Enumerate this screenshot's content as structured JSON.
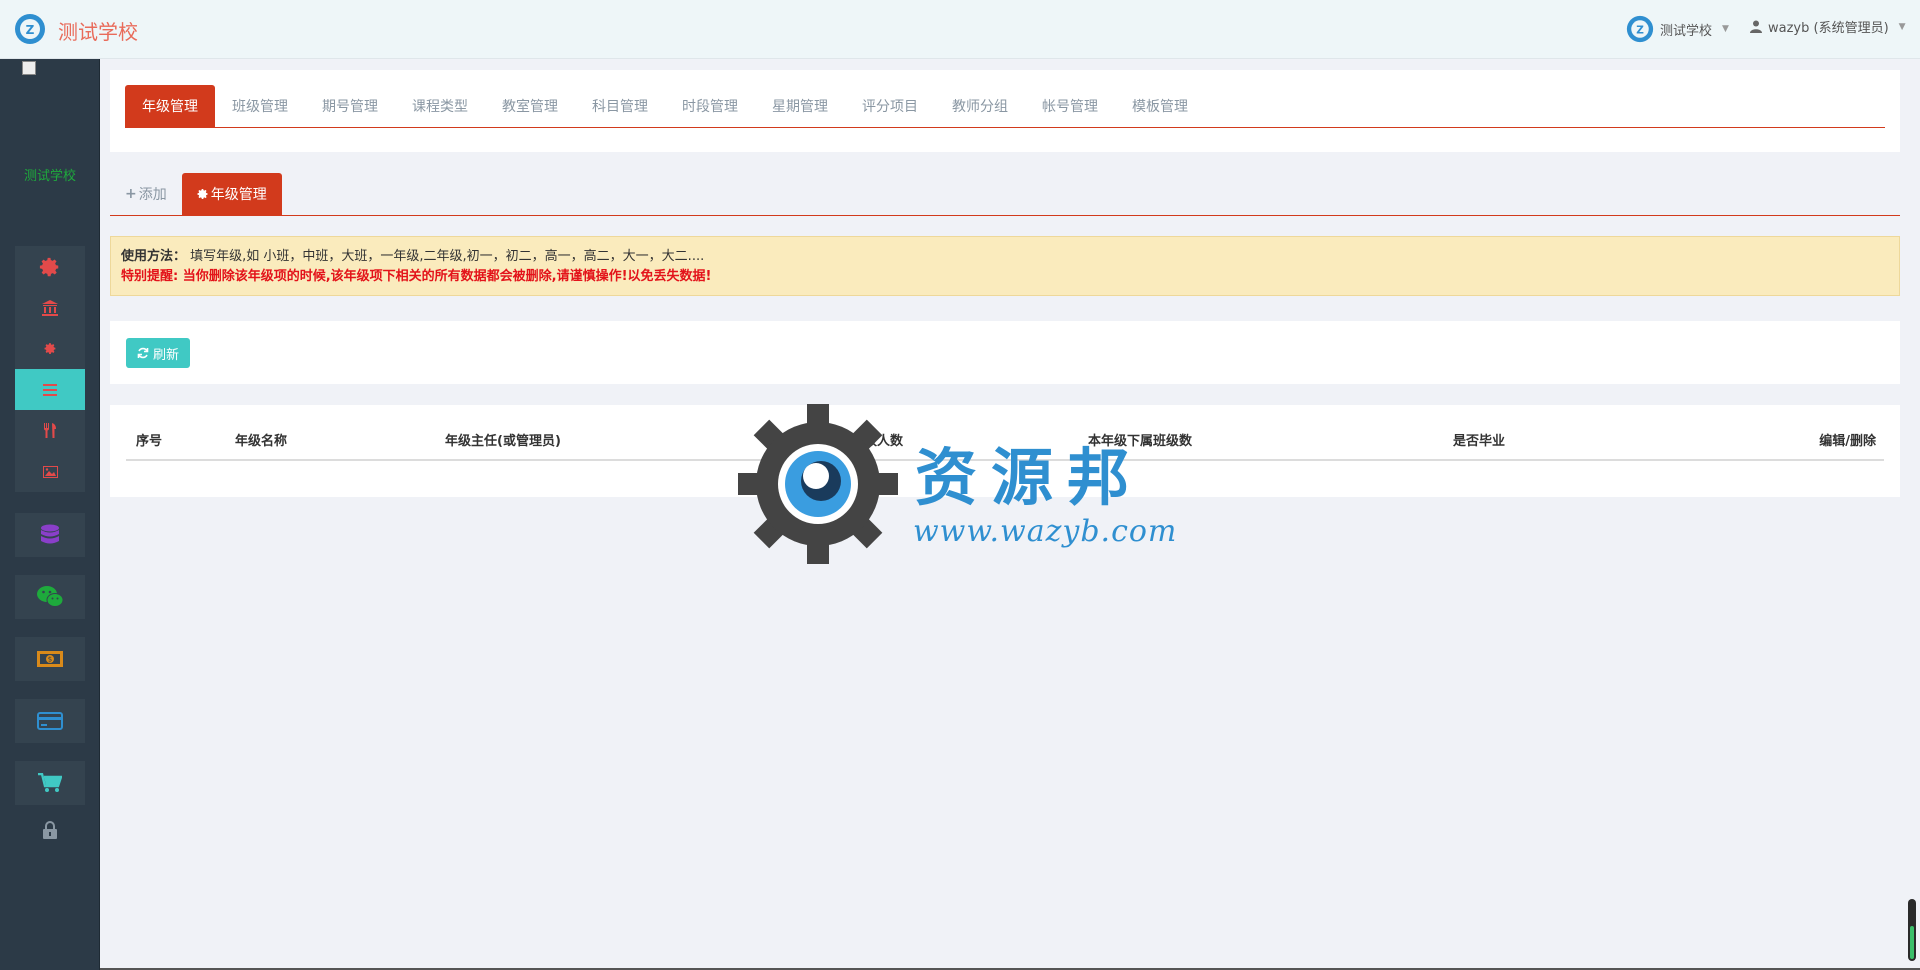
{
  "topbar": {
    "brand": "测试学校",
    "school_switch": "测试学校",
    "user": "wazyb (系统管理员)"
  },
  "sidebar": {
    "school_name": "测试学校",
    "items": [
      {
        "icon": "gear-icon"
      },
      {
        "icon": "bank-icon"
      },
      {
        "icon": "small-gear-icon"
      },
      {
        "icon": "list-icon",
        "active": true
      },
      {
        "icon": "cutlery-icon"
      },
      {
        "icon": "image-icon"
      },
      {
        "icon": "database-icon"
      },
      {
        "icon": "wechat-icon"
      },
      {
        "icon": "money-icon"
      },
      {
        "icon": "credit-card-icon"
      },
      {
        "icon": "cart-icon"
      },
      {
        "icon": "lock-icon"
      }
    ]
  },
  "top_tabs": [
    "年级管理",
    "班级管理",
    "期号管理",
    "课程类型",
    "教室管理",
    "科目管理",
    "时段管理",
    "星期管理",
    "评分项目",
    "教师分组",
    "帐号管理",
    "模板管理"
  ],
  "active_top_tab": "年级管理",
  "sub_tabs": {
    "add": "添加",
    "manage": "年级管理"
  },
  "notice": {
    "usage_label": "使用方法：",
    "usage_text": "填写年级,如 小班，中班，大班，一年级,二年级,初一，初二，高一，高二，大一，大二....",
    "warning": "特别提醒: 当你删除该年级项的时候,该年级项下相关的所有数据都会被删除,请谨慎操作!以免丢失数据!"
  },
  "refresh_label": "刷新",
  "table": {
    "columns": [
      "序号",
      "年级名称",
      "年级主任(或管理员)",
      "本年级人数",
      "本年级下属班级数",
      "是否毕业",
      "编辑/删除"
    ]
  },
  "watermark": {
    "title": "资源邦",
    "url": "www.wazyb.com"
  },
  "colors": {
    "accent_red": "#d23a1c",
    "teal": "#40c9c4",
    "sidebar_bg": "#2c3a47",
    "notice_bg": "#faebbd",
    "warning_red": "#e3131a"
  }
}
